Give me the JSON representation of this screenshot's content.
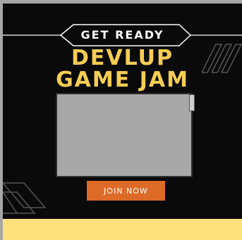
{
  "banner": {
    "tag": "GET READY",
    "title_line1": "DEVLUP",
    "title_line2": "GAME JAM",
    "cta_label": "JOIN NOW"
  },
  "colors": {
    "background": "#0a0a0a",
    "title": "#f6cd54",
    "button": "#dd6b27",
    "footer": "#fde17c"
  },
  "icons": [
    "slash-stripes-decoration",
    "corner-stripes-decoration"
  ]
}
